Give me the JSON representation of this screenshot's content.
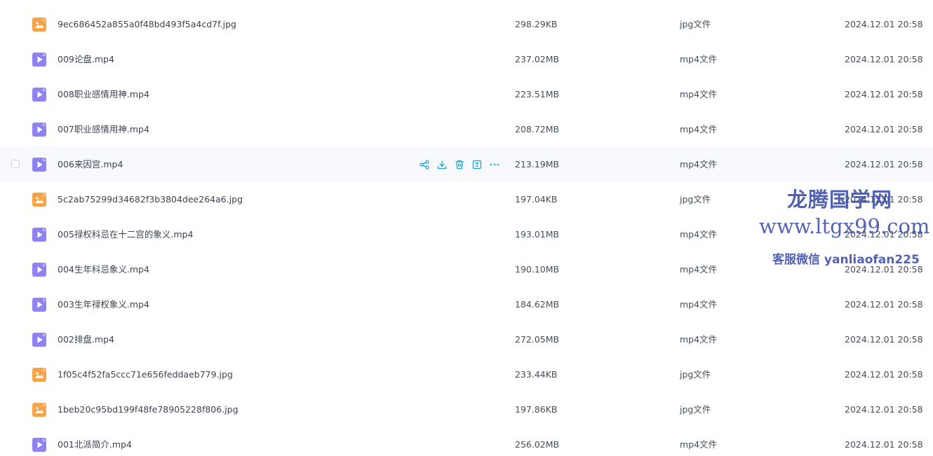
{
  "files": [
    {
      "name": "9ec686452a855a0f48bd493f5a4cd7f.jpg",
      "size": "298.29KB",
      "type": "jpg文件",
      "date": "2024.12.01 20:58",
      "kind": "image"
    },
    {
      "name": "009论盘.mp4",
      "size": "237.02MB",
      "type": "mp4文件",
      "date": "2024.12.01 20:58",
      "kind": "video"
    },
    {
      "name": "008职业感情用神.mp4",
      "size": "223.51MB",
      "type": "mp4文件",
      "date": "2024.12.01 20:58",
      "kind": "video"
    },
    {
      "name": "007职业感情用神.mp4",
      "size": "208.72MB",
      "type": "mp4文件",
      "date": "2024.12.01 20:58",
      "kind": "video"
    },
    {
      "name": "006来因宫.mp4",
      "size": "213.19MB",
      "type": "mp4文件",
      "date": "2024.12.01 20:58",
      "kind": "video",
      "hovered": true
    },
    {
      "name": "5c2ab75299d34682f3b3804dee264a6.jpg",
      "size": "197.04KB",
      "type": "jpg文件",
      "date": "2024.12.01 20:58",
      "kind": "image"
    },
    {
      "name": "005禄权科忌在十二宫的象义.mp4",
      "size": "193.01MB",
      "type": "mp4文件",
      "date": "2024.12.01 20:58",
      "kind": "video"
    },
    {
      "name": "004生年科忌象义.mp4",
      "size": "190.10MB",
      "type": "mp4文件",
      "date": "2024.12.01 20:58",
      "kind": "video"
    },
    {
      "name": "003生年禄权象义.mp4",
      "size": "184.62MB",
      "type": "mp4文件",
      "date": "2024.12.01 20:58",
      "kind": "video"
    },
    {
      "name": "002排盘.mp4",
      "size": "272.05MB",
      "type": "mp4文件",
      "date": "2024.12.01 20:58",
      "kind": "video"
    },
    {
      "name": "1f05c4f52fa5ccc71e656feddaeb779.jpg",
      "size": "233.44KB",
      "type": "jpg文件",
      "date": "2024.12.01 20:58",
      "kind": "image"
    },
    {
      "name": "1beb20c95bd199f48fe78905228f806.jpg",
      "size": "197.86KB",
      "type": "jpg文件",
      "date": "2024.12.01 20:58",
      "kind": "image"
    },
    {
      "name": "001北派简介.mp4",
      "size": "256.02MB",
      "type": "mp4文件",
      "date": "2024.12.01 20:58",
      "kind": "video"
    }
  ],
  "row_actions": [
    "share-icon",
    "download-icon",
    "delete-icon",
    "rename-icon",
    "more-icon"
  ],
  "icons": {
    "image": "image-file-icon",
    "video": "video-file-icon"
  },
  "colors": {
    "image_icon": "#f5a44a",
    "video_icon": "#8e83f0",
    "action_icon": "#1aa5d8",
    "hover_row": "#f7f9fc",
    "watermark": "#3b4ea8"
  },
  "watermark": {
    "title": "龙腾国学网",
    "url": "www.ltgx99.com",
    "contact": "客服微信 yanliaofan225"
  }
}
